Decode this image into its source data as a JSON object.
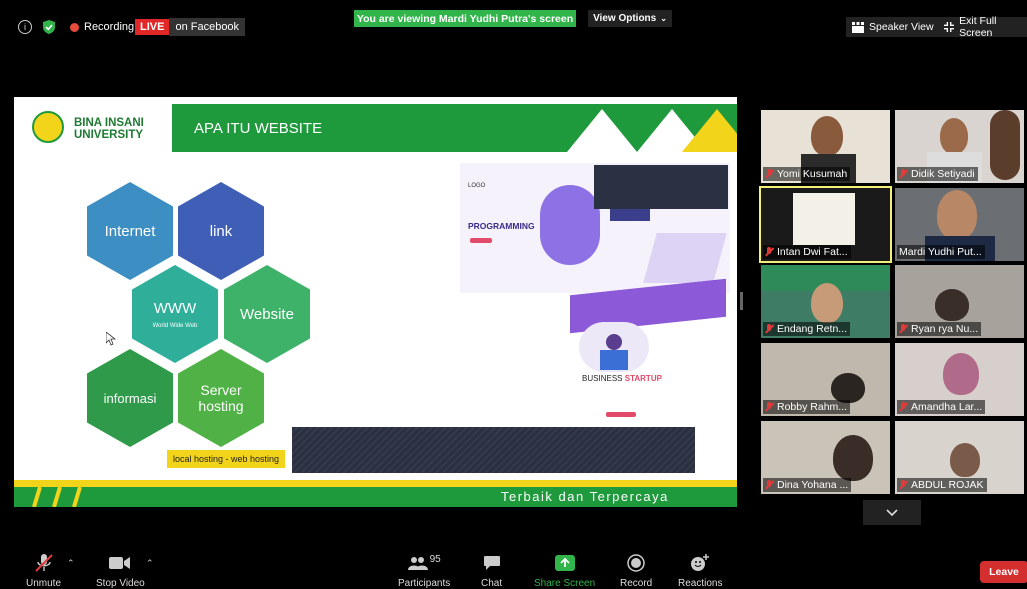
{
  "topbar": {
    "recording": "Recording",
    "live": "LIVE",
    "facebook": "on Facebook",
    "viewing_banner": "You are viewing Mardi Yudhi Putra's screen",
    "view_options": "View Options",
    "speaker_view": "Speaker View",
    "exit_full_screen": "Exit Full Screen"
  },
  "slide": {
    "logo_line1": "BINA INSANI",
    "logo_line2": "UNIVERSITY",
    "title": "APA ITU WEBSITE",
    "hexagons": {
      "internet": "Internet",
      "link": "link",
      "www": "WWW",
      "www_sub": "World Wide Web",
      "website": "Website",
      "informasi": "informasi",
      "server": "Server hosting"
    },
    "hosting_note": "local hosting - web hosting",
    "programming_logo": "LOGO",
    "programming": "PROGRAMMING",
    "business": "BUSINESS",
    "startup": "STARTUP",
    "footer_tagline": "Terbaik dan Terpercaya"
  },
  "gallery": {
    "participants": [
      "Yomi Kusumah",
      "Didik Setiyadi",
      "Intan Dwi Fat...",
      "Mardi Yudhi Put...",
      "Endang Retn...",
      "Ryan rya Nu...",
      "Robby Rahm...",
      "Amandha Lar...",
      "Dina Yohana ...",
      "ABDUL ROJAK"
    ]
  },
  "toolbar": {
    "unmute": "Unmute",
    "stop_video": "Stop Video",
    "participants": "Participants",
    "participants_count": "95",
    "chat": "Chat",
    "share_screen": "Share Screen",
    "record": "Record",
    "reactions": "Reactions",
    "leave": "Leave"
  },
  "colors": {
    "live_red": "#e02828",
    "zoom_green": "#31b44a",
    "slide_green": "#1e9a3c",
    "slide_yellow": "#f2d41a",
    "leave_red": "#d32f2f"
  }
}
